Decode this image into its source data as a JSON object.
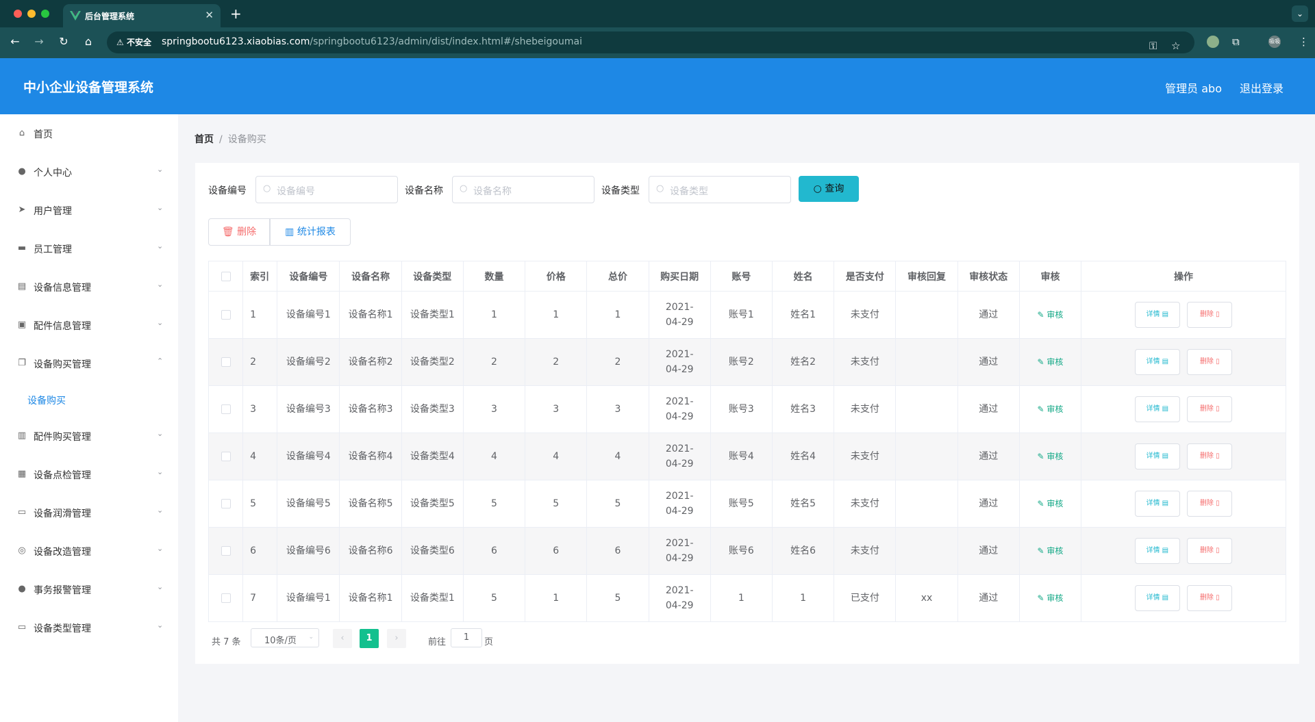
{
  "browser": {
    "tab_title": "后台管理系统",
    "tab_close": "✕",
    "new_tab": "+",
    "insecure_label": "不安全",
    "url_host": "springbootu6123.xiaobias.com",
    "url_path": "/springbootu6123/admin/dist/index.html#/shebeigoumai",
    "profile_label": "吸吸"
  },
  "header": {
    "title": "中小企业设备管理系统",
    "user": "管理员 abo",
    "logout": "退出登录"
  },
  "sidebar": {
    "items": [
      {
        "label": "首页",
        "icon": "home-icon",
        "glyph": "⌂",
        "arrow": ""
      },
      {
        "label": "个人中心",
        "icon": "user-icon",
        "glyph": "●",
        "arrow": "⌄"
      },
      {
        "label": "用户管理",
        "icon": "send-icon",
        "glyph": "➤",
        "arrow": "⌄"
      },
      {
        "label": "员工管理",
        "icon": "monitor-icon",
        "glyph": "▬",
        "arrow": "⌄"
      },
      {
        "label": "设备信息管理",
        "icon": "clipboard-icon",
        "glyph": "▤",
        "arrow": "⌄"
      },
      {
        "label": "配件信息管理",
        "icon": "camera-icon",
        "glyph": "▣",
        "arrow": "⌄"
      },
      {
        "label": "设备购买管理",
        "icon": "copy-icon",
        "glyph": "❐",
        "arrow": "⌃"
      },
      {
        "label": "配件购买管理",
        "icon": "bar-chart-icon",
        "glyph": "▥",
        "arrow": "⌄"
      },
      {
        "label": "设备点检管理",
        "icon": "check-clipboard-icon",
        "glyph": "▦",
        "arrow": "⌄"
      },
      {
        "label": "设备润滑管理",
        "icon": "chat-icon",
        "glyph": "▭",
        "arrow": "⌄"
      },
      {
        "label": "设备改造管理",
        "icon": "compass-icon",
        "glyph": "◎",
        "arrow": "⌄"
      },
      {
        "label": "事务报警管理",
        "icon": "person-icon",
        "glyph": "●",
        "arrow": "⌄"
      },
      {
        "label": "设备类型管理",
        "icon": "card-icon",
        "glyph": "▭",
        "arrow": "⌄"
      }
    ],
    "active_sub": "设备购买"
  },
  "breadcrumb": {
    "home": "首页",
    "separator": "/",
    "current": "设备购买"
  },
  "search": {
    "fields": [
      {
        "label": "设备编号",
        "placeholder": "设备编号"
      },
      {
        "label": "设备名称",
        "placeholder": "设备名称"
      },
      {
        "label": "设备类型",
        "placeholder": "设备类型"
      }
    ],
    "query_button": "查询"
  },
  "toolbar": {
    "delete_label": "删除",
    "stats_label": "统计报表"
  },
  "table": {
    "headers": [
      "索引",
      "设备编号",
      "设备名称",
      "设备类型",
      "数量",
      "价格",
      "总价",
      "购买日期",
      "账号",
      "姓名",
      "是否支付",
      "审核回复",
      "审核状态",
      "审核",
      "操作"
    ],
    "audit_label": "审核",
    "detail_label": "详情",
    "remove_label": "删除",
    "rows": [
      {
        "index": "1",
        "code": "设备编号1",
        "name": "设备名称1",
        "type": "设备类型1",
        "qty": "1",
        "price": "1",
        "total": "1",
        "date": "2021-04-29",
        "account": "账号1",
        "person": "姓名1",
        "paid": "未支付",
        "reply": "",
        "status": "通过"
      },
      {
        "index": "2",
        "code": "设备编号2",
        "name": "设备名称2",
        "type": "设备类型2",
        "qty": "2",
        "price": "2",
        "total": "2",
        "date": "2021-04-29",
        "account": "账号2",
        "person": "姓名2",
        "paid": "未支付",
        "reply": "",
        "status": "通过"
      },
      {
        "index": "3",
        "code": "设备编号3",
        "name": "设备名称3",
        "type": "设备类型3",
        "qty": "3",
        "price": "3",
        "total": "3",
        "date": "2021-04-29",
        "account": "账号3",
        "person": "姓名3",
        "paid": "未支付",
        "reply": "",
        "status": "通过"
      },
      {
        "index": "4",
        "code": "设备编号4",
        "name": "设备名称4",
        "type": "设备类型4",
        "qty": "4",
        "price": "4",
        "total": "4",
        "date": "2021-04-29",
        "account": "账号4",
        "person": "姓名4",
        "paid": "未支付",
        "reply": "",
        "status": "通过"
      },
      {
        "index": "5",
        "code": "设备编号5",
        "name": "设备名称5",
        "type": "设备类型5",
        "qty": "5",
        "price": "5",
        "total": "5",
        "date": "2021-04-29",
        "account": "账号5",
        "person": "姓名5",
        "paid": "未支付",
        "reply": "",
        "status": "通过"
      },
      {
        "index": "6",
        "code": "设备编号6",
        "name": "设备名称6",
        "type": "设备类型6",
        "qty": "6",
        "price": "6",
        "total": "6",
        "date": "2021-04-29",
        "account": "账号6",
        "person": "姓名6",
        "paid": "未支付",
        "reply": "",
        "status": "通过"
      },
      {
        "index": "7",
        "code": "设备编号1",
        "name": "设备名称1",
        "type": "设备类型1",
        "qty": "5",
        "price": "1",
        "total": "5",
        "date": "2021-04-29",
        "account": "1",
        "person": "1",
        "paid": "已支付",
        "reply": "xx",
        "status": "通过"
      }
    ]
  },
  "pagination": {
    "total": "共 7 条",
    "page_size": "10条/页",
    "current_page": "1",
    "goto_label": "前往",
    "goto_value": "1",
    "page_suffix": "页"
  },
  "colors": {
    "header_bg": "#1e88e5",
    "query_button": "#22b8cf",
    "current_page": "#13c08e",
    "danger": "#f56c6c"
  }
}
